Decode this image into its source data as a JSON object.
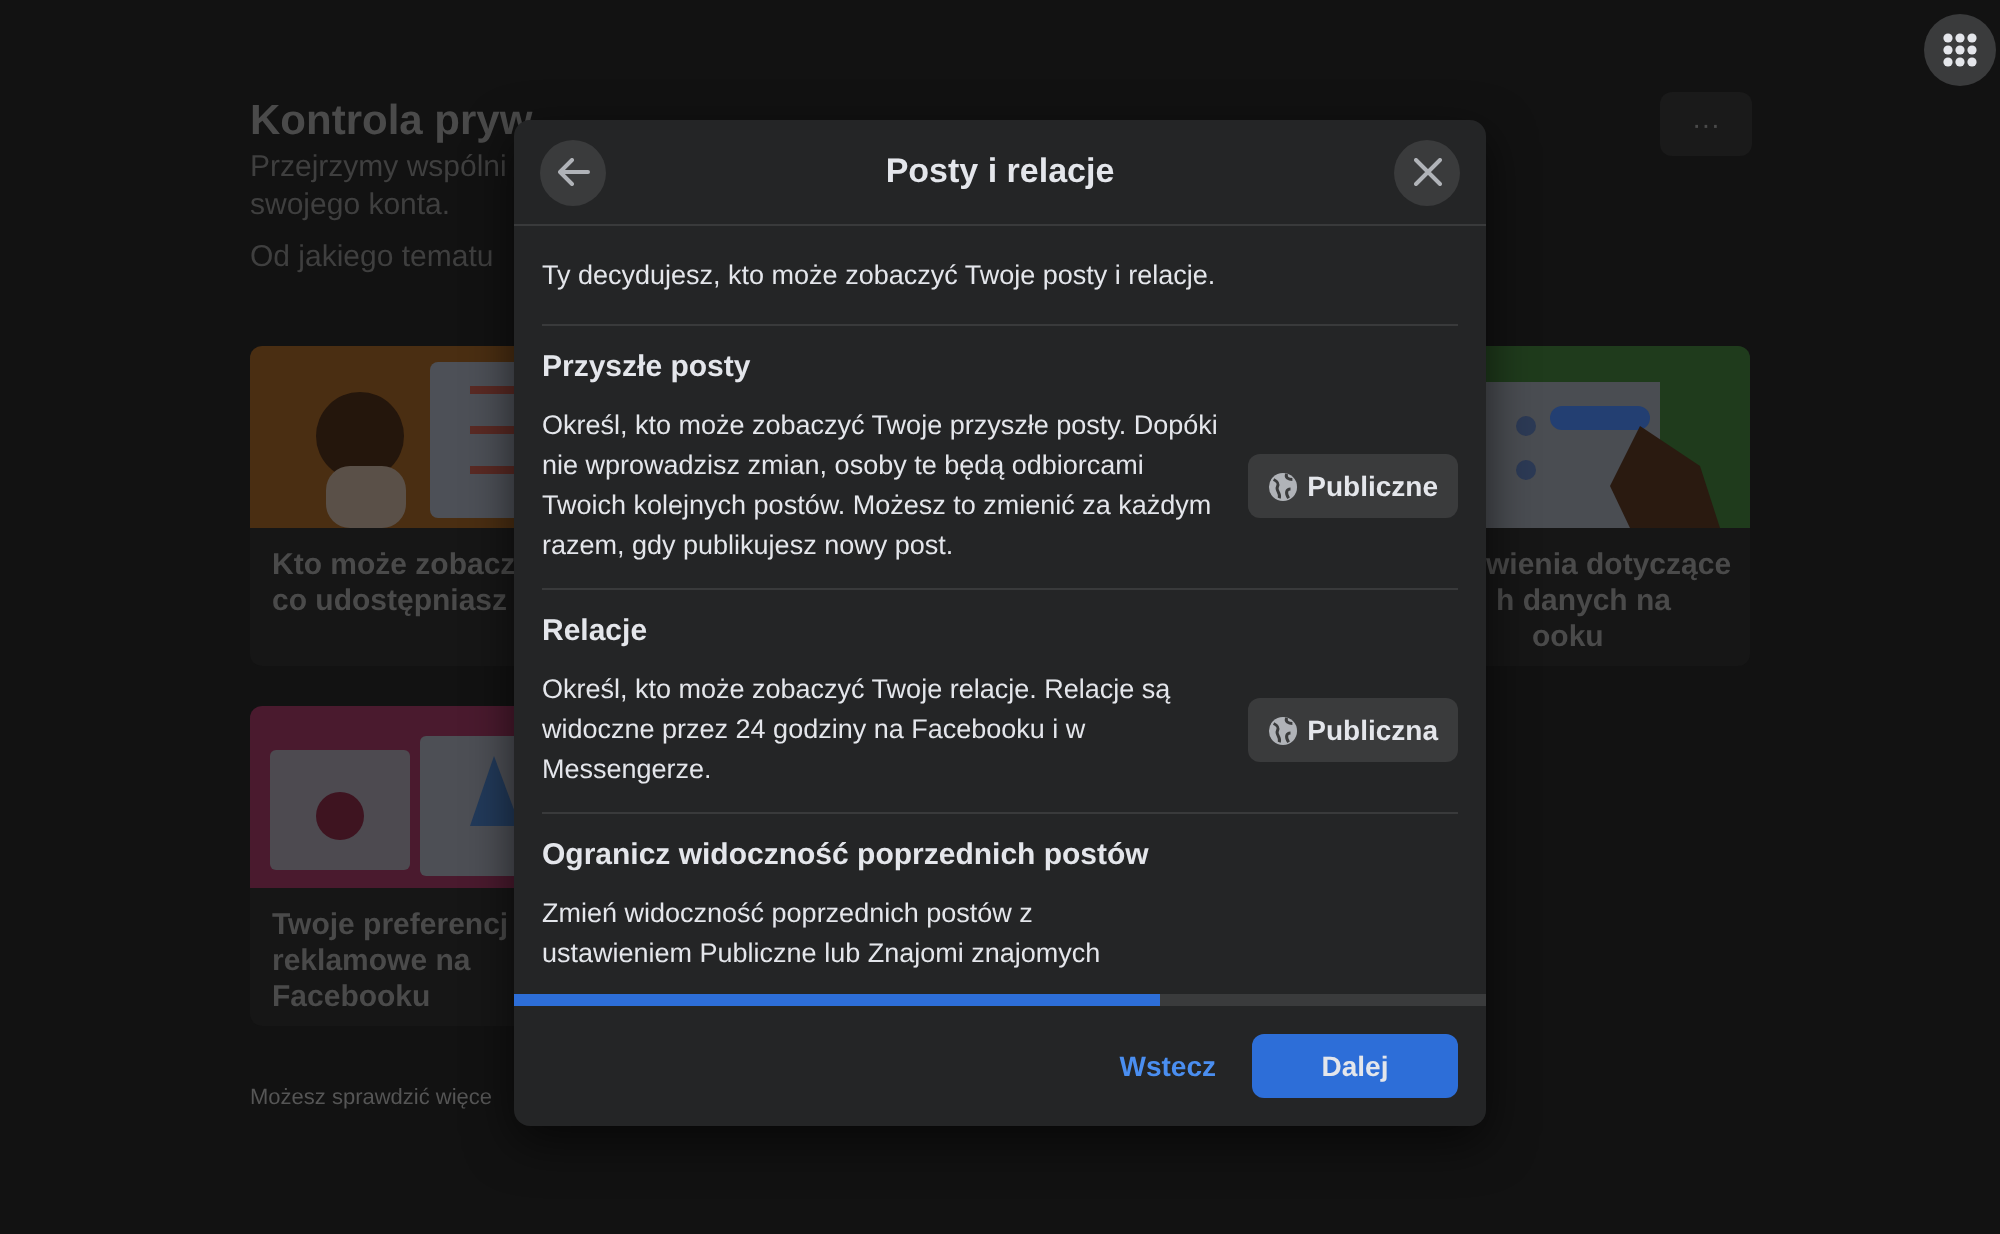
{
  "background": {
    "title": "Kontrola pryw",
    "subtitle_lines": [
      "Przejrzymy wspólni",
      "swojego konta."
    ],
    "question": "Od jakiego tematu",
    "more_button": "···",
    "cards": [
      {
        "title_lines": [
          "Kto może zobacz",
          "co udostępniasz"
        ],
        "kind": "orange"
      },
      {
        "title_lines": [
          "wienia dotyczące",
          "h danych na",
          "ooku"
        ],
        "kind": "green"
      },
      {
        "title_lines": [
          "Twoje preferencj",
          "reklamowe na",
          "Facebooku"
        ],
        "kind": "pink"
      }
    ],
    "footer_note": "Możesz sprawdzić więce"
  },
  "dialog": {
    "title": "Posty i relacje",
    "intro": "Ty decydujesz, kto może zobaczyć Twoje posty i relacje.",
    "sections": [
      {
        "heading": "Przyszłe posty",
        "description": "Określ, kto może zobaczyć Twoje przyszłe posty. Dopóki nie wprowadzisz zmian, osoby te będą odbiorcami Twoich kolejnych postów. Możesz to zmienić za każdym razem, gdy publikujesz nowy post.",
        "button": "Publiczne"
      },
      {
        "heading": "Relacje",
        "description": "Określ, kto może zobaczyć Twoje relacje. Relacje są widoczne przez 24 godziny na Facebooku i w Messengerze.",
        "button": "Publiczna"
      },
      {
        "heading": "Ogranicz widoczność poprzednich postów",
        "description": "Zmień widoczność poprzednich postów z ustawieniem Publiczne lub Znajomi znajomych"
      }
    ],
    "progress": {
      "level": 0.665
    },
    "back_link": "Wstecz",
    "next_button": "Dalej"
  }
}
